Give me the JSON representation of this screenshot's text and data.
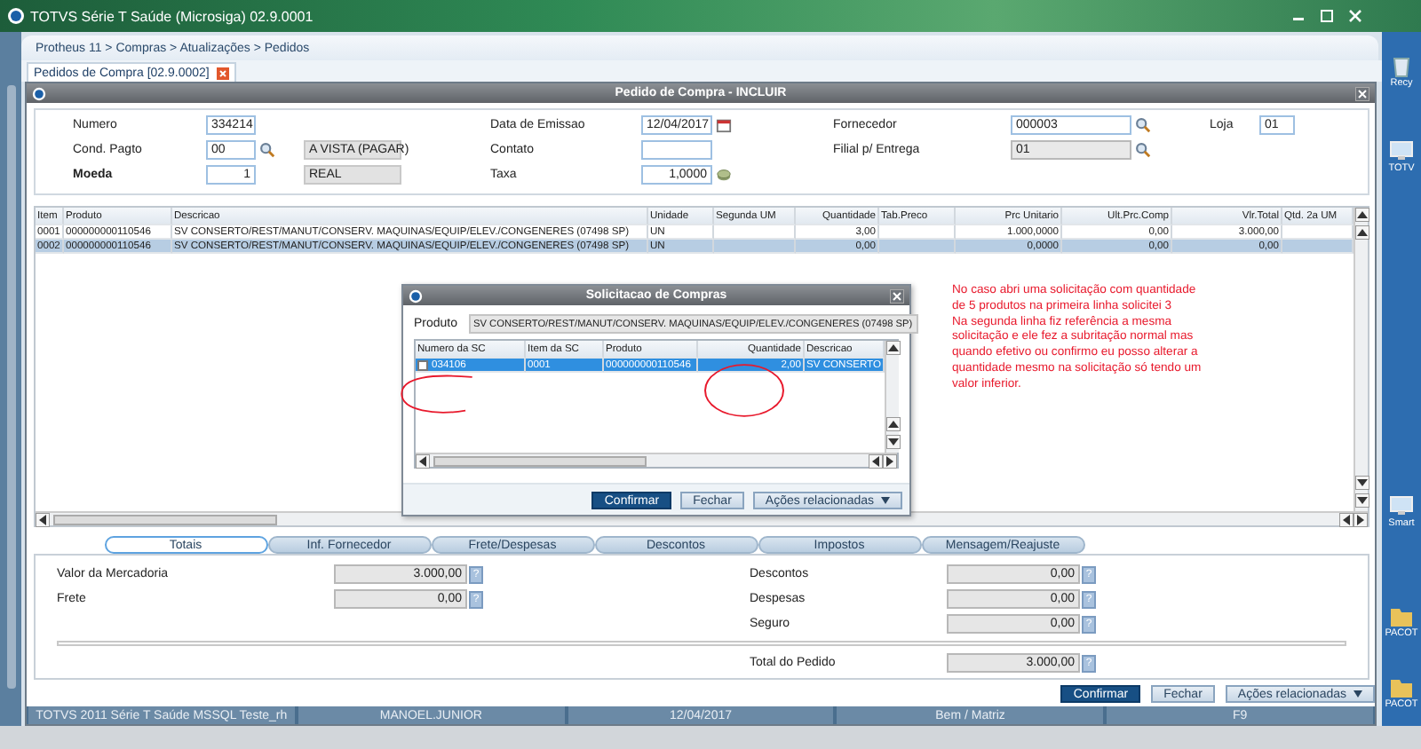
{
  "app_title": "TOTVS Série T Saúde (Microsiga) 02.9.0001",
  "breadcrumb": "Protheus 11 > Compras > Atualizações > Pedidos",
  "doc_tab": {
    "label": "Pedidos de Compra [02.9.0002]"
  },
  "form": {
    "title": "Pedido de Compra - INCLUIR",
    "rows": [
      [
        {
          "label": "Numero",
          "value": "334214",
          "kind": "text",
          "readonly": false
        },
        {
          "label": "Data de Emissao",
          "value": "12/04/2017",
          "kind": "date",
          "readonly": false
        },
        {
          "label": "Fornecedor",
          "value": "000003",
          "kind": "lookup",
          "readonly": false
        },
        {
          "label": "Loja",
          "value": "01",
          "kind": "text",
          "readonly": false
        }
      ],
      [
        {
          "label": "Cond. Pagto",
          "value": "00",
          "kind": "lookup",
          "readonly": false,
          "description": "A VISTA (PAGAR)"
        },
        {
          "label": "Contato",
          "kind": "text",
          "readonly": false
        },
        {
          "label": "Filial p/ Entrega",
          "value": "01",
          "kind": "lookup",
          "readonly": true
        },
        null
      ],
      [
        {
          "label": "Moeda",
          "value": "1",
          "kind": "number",
          "readonly": false,
          "description": "REAL"
        },
        {
          "label": "Taxa",
          "value": "1,0000",
          "kind": "currency",
          "readonly": false
        },
        null,
        null
      ]
    ]
  },
  "grid": {
    "columns": [
      "Item",
      "Produto",
      "Descricao",
      "Unidade",
      "Segunda UM",
      "Quantidade",
      "Tab.Preco",
      "Prc Unitario",
      "Ult.Prc.Comp",
      "Vlr.Total",
      "Qtd. 2a UM"
    ],
    "rows": [
      {
        "selected": false,
        "cells": [
          "0001",
          "000000000110546",
          "SV CONSERTO/REST/MANUT/CONSERV. MAQUINAS/EQUIP/ELEV./CONGENERES (07498 SP)",
          "UN",
          null,
          "3,00",
          null,
          "1.000,0000",
          "0,00",
          "3.000,00",
          null
        ]
      },
      {
        "selected": true,
        "cells": [
          "0002",
          "000000000110546",
          "SV CONSERTO/REST/MANUT/CONSERV. MAQUINAS/EQUIP/ELEV./CONGENERES (07498 SP)",
          "UN",
          null,
          "0,00",
          null,
          "0,0000",
          "0,00",
          "0,00",
          null
        ]
      }
    ]
  },
  "dialog": {
    "title": "Solicitacao de Compras",
    "product_label": "Produto",
    "product_value": "SV CONSERTO/REST/MANUT/CONSERV. MAQUINAS/EQUIP/ELEV./CONGENERES (07498 SP)",
    "columns": [
      "Numero da SC",
      "Item da SC",
      "Produto",
      "Quantidade",
      "Descricao"
    ],
    "rows": [
      {
        "selected": true,
        "checked": false,
        "cells": [
          "034106",
          "0001",
          "000000000110546",
          "2,00",
          "SV CONSERTO"
        ]
      }
    ],
    "buttons": [
      {
        "label": "Confirmar",
        "kind": "primary"
      },
      {
        "label": "Fechar",
        "kind": "secondary"
      },
      {
        "label": "Ações relacionadas",
        "kind": "menu"
      }
    ]
  },
  "annotation": "No caso abri uma  solicitação com quantidade\nde 5 produtos na primeira linha solicitei 3\nNa segunda linha fiz referência a mesma\nsolicitação e ele fez a subritação normal mas\nquando efetivo ou confirmo eu posso alterar a\nquantidade mesmo na solicitação só tendo um\nvalor inferior.",
  "folders": [
    {
      "label": "Totais",
      "selected": true
    },
    {
      "label": "Inf. Fornecedor",
      "selected": false
    },
    {
      "label": "Frete/Despesas",
      "selected": false
    },
    {
      "label": "Descontos",
      "selected": false
    },
    {
      "label": "Impostos",
      "selected": false
    },
    {
      "label": "Mensagem/Reajuste",
      "selected": false
    }
  ],
  "totals": {
    "left": [
      {
        "label": "Valor da Mercadoria",
        "value": "3.000,00",
        "help": "?"
      },
      {
        "label": "Frete",
        "value": "0,00",
        "help": "?"
      }
    ],
    "right": [
      {
        "label": "Descontos",
        "value": "0,00",
        "help": "?"
      },
      {
        "label": "Despesas",
        "value": "0,00",
        "help": "?"
      },
      {
        "label": "Seguro",
        "value": "0,00",
        "help": "?"
      }
    ],
    "total": {
      "label": "Total do Pedido",
      "value": "3.000,00",
      "help": "?"
    }
  },
  "buttons": [
    {
      "label": "Confirmar",
      "kind": "primary"
    },
    {
      "label": "Fechar",
      "kind": "secondary"
    },
    {
      "label": "Ações relacionadas",
      "kind": "menu"
    }
  ],
  "status_bar": [
    "TOTVS 2011 Série T Saúde MSSQL Teste_rh",
    "MANOEL.JUNIOR",
    "12/04/2017",
    "Bem / Matriz",
    "F9"
  ],
  "desktop_icons": [
    {
      "label": "Recy",
      "kind": "bin"
    },
    {
      "label": "TOTV",
      "kind": "app"
    },
    {
      "label": "Smart",
      "kind": "app"
    },
    {
      "label": "PACOT",
      "kind": "folder"
    },
    {
      "label": "PACOT",
      "kind": "folder"
    }
  ]
}
